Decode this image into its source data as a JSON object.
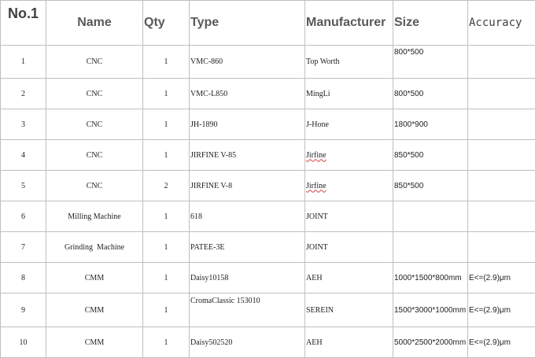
{
  "table": {
    "headers": {
      "no": "No.1",
      "name": "Name",
      "qty": "Qty",
      "type": "Type",
      "manufacturer": "Manufacturer",
      "size": "Size",
      "accuracy": "Accuracy"
    },
    "rows": [
      {
        "no": "1",
        "name": "CNC",
        "qty": "1",
        "type": "VMC-860",
        "manufacturer": "Top Worth",
        "size": "800*500",
        "accuracy": ""
      },
      {
        "no": "2",
        "name": "CNC",
        "qty": "1",
        "type": "VMC-L850",
        "manufacturer": "MingLi",
        "size": "800*500",
        "accuracy": ""
      },
      {
        "no": "3",
        "name": "CNC",
        "qty": "1",
        "type": "JH-1890",
        "manufacturer": "J-Hone",
        "size": "1800*900",
        "accuracy": ""
      },
      {
        "no": "4",
        "name": "CNC",
        "qty": "1",
        "type": "JIRFINE V-85",
        "manufacturer": "Jirfine",
        "size": "850*500",
        "accuracy": ""
      },
      {
        "no": "5",
        "name": "CNC",
        "qty": "2",
        "type": "JIRFINE V-8",
        "manufacturer": "Jirfine",
        "size": "850*500",
        "accuracy": ""
      },
      {
        "no": "6",
        "name": "Milling Machine",
        "qty": "1",
        "type": "618",
        "manufacturer": "JOINT",
        "size": "",
        "accuracy": ""
      },
      {
        "no": "7",
        "name": "Grinding  Machine",
        "qty": "1",
        "type": "PATEE-3E",
        "manufacturer": "JOINT",
        "size": "",
        "accuracy": ""
      },
      {
        "no": "8",
        "name": "CMM",
        "qty": "1",
        "type": "Daisy10158",
        "manufacturer": "AEH",
        "size": "1000*1500*800mm",
        "accuracy": "E<=(2.9)μm"
      },
      {
        "no": "9",
        "name": "CMM",
        "qty": "1",
        "type": "CromaClassic 153010",
        "manufacturer": "SEREIN",
        "size": "1500*3000*1000mm",
        "accuracy": "E<=(2.9)μm"
      },
      {
        "no": "10",
        "name": "CMM",
        "qty": "1",
        "type": "Daisy502520",
        "manufacturer": "AEH",
        "size": "5000*2500*2000mm",
        "accuracy": "E<=(2.9)μm"
      }
    ]
  }
}
